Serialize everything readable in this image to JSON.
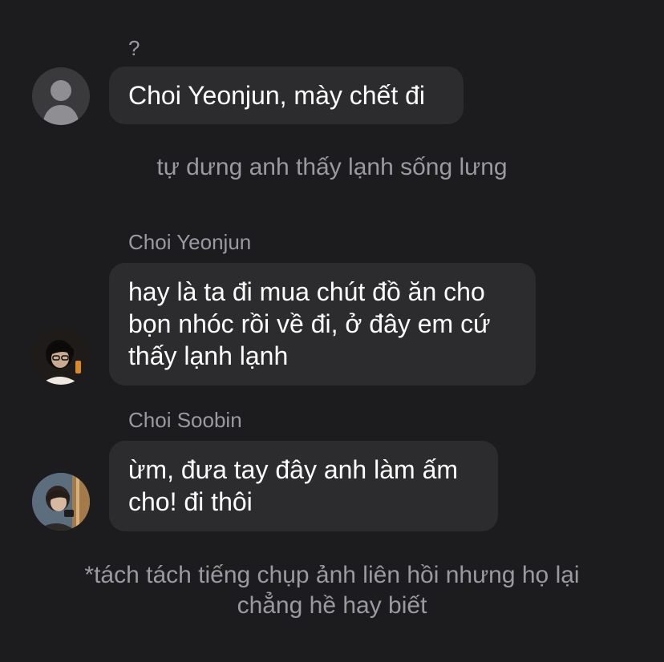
{
  "messages": [
    {
      "sender": "?",
      "text": "Choi Yeonjun, mày chết đi"
    },
    {
      "sender": "Choi Yeonjun",
      "text": "hay là ta đi mua chút đồ ăn cho bọn nhóc rồi về đi, ở đây em cứ thấy lạnh lạnh"
    },
    {
      "sender": "Choi Soobin",
      "text": "ừm, đưa tay đây anh làm ấm cho! đi thôi"
    }
  ],
  "narrations": [
    "tự dưng anh thấy lạnh sống lưng",
    "*tách tách tiếng chụp ảnh liên hồi nhưng họ lại chẳng hề hay biết"
  ]
}
